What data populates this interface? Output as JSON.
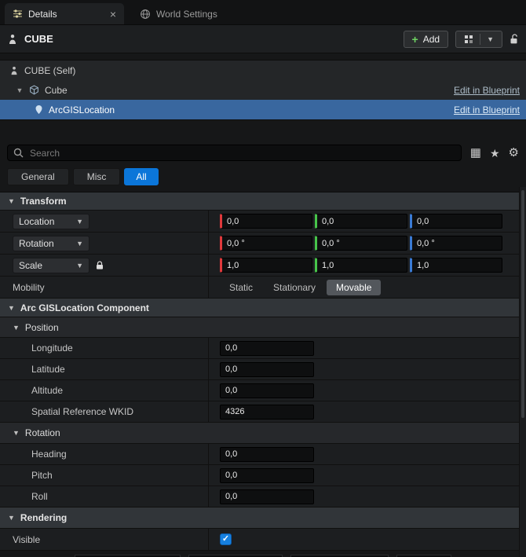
{
  "tabs": [
    {
      "label": "Details"
    },
    {
      "label": "World Settings"
    }
  ],
  "header": {
    "title": "CUBE",
    "add_button": "Add"
  },
  "tree": [
    {
      "label": "CUBE (Self)"
    },
    {
      "label": "Cube",
      "link": "Edit in Blueprint"
    },
    {
      "label": "ArcGISLocation",
      "link": "Edit in Blueprint",
      "selected": true
    }
  ],
  "search": {
    "placeholder": "Search"
  },
  "filters": {
    "general": "General",
    "misc": "Misc",
    "all": "All",
    "active": "All"
  },
  "transform": {
    "title": "Transform",
    "location": {
      "label": "Location",
      "x": "0,0",
      "y": "0,0",
      "z": "0,0"
    },
    "rotation": {
      "label": "Rotation",
      "x": "0,0 °",
      "y": "0,0 °",
      "z": "0,0 °"
    },
    "scale": {
      "label": "Scale",
      "x": "1,0",
      "y": "1,0",
      "z": "1,0"
    },
    "mobility": {
      "label": "Mobility",
      "static": "Static",
      "stationary": "Stationary",
      "movable": "Movable",
      "selected": "Movable"
    }
  },
  "arcgis": {
    "title": "Arc GISLocation Component",
    "position": {
      "title": "Position",
      "rows": [
        {
          "label": "Longitude",
          "value": "0,0"
        },
        {
          "label": "Latitude",
          "value": "0,0"
        },
        {
          "label": "Altitude",
          "value": "0,0"
        },
        {
          "label": "Spatial Reference WKID",
          "value": "4326"
        }
      ]
    },
    "rotation": {
      "title": "Rotation",
      "rows": [
        {
          "label": "Heading",
          "value": "0,0"
        },
        {
          "label": "Pitch",
          "value": "0,0"
        },
        {
          "label": "Roll",
          "value": "0,0"
        }
      ]
    }
  },
  "rendering": {
    "title": "Rendering",
    "visible_label": "Visible",
    "visible_checked": true
  },
  "colors": {
    "accent_blue": "#0b76d9",
    "selection_blue": "#39679f",
    "axis_red": "#e0393c",
    "axis_green": "#47c54a",
    "axis_blue": "#3a7bd5",
    "add_green": "#6fd262"
  }
}
